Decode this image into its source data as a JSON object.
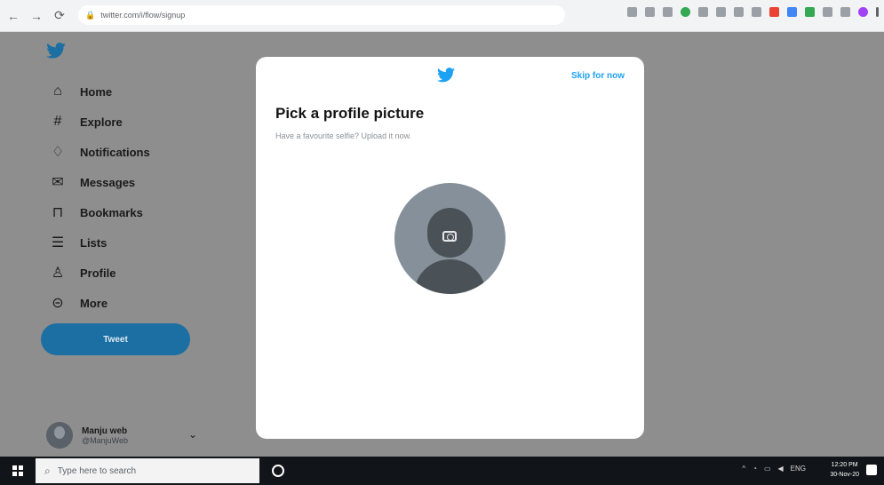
{
  "browser": {
    "url": "twitter.com/i/flow/signup",
    "nav_icons": [
      "back-icon",
      "forward-icon",
      "reload-icon"
    ]
  },
  "sidebar": {
    "items": [
      {
        "label": "Home",
        "icon": "home-icon",
        "glyph": "⌂"
      },
      {
        "label": "Explore",
        "icon": "hashtag-icon",
        "glyph": "#"
      },
      {
        "label": "Notifications",
        "icon": "bell-icon",
        "glyph": "🔔"
      },
      {
        "label": "Messages",
        "icon": "envelope-icon",
        "glyph": "✉"
      },
      {
        "label": "Bookmarks",
        "icon": "bookmark-icon",
        "glyph": "🔖"
      },
      {
        "label": "Lists",
        "icon": "list-icon",
        "glyph": "☰"
      },
      {
        "label": "Profile",
        "icon": "person-icon",
        "glyph": "👤"
      },
      {
        "label": "More",
        "icon": "more-icon",
        "glyph": "⋯"
      }
    ],
    "tweet_label": "Tweet",
    "account": {
      "name": "Manju web",
      "handle": "@ManjuWeb"
    }
  },
  "modal": {
    "skip_label": "Skip for now",
    "title": "Pick a profile picture",
    "subtitle": "Have a favourite selfie? Upload it now."
  },
  "taskbar": {
    "search_placeholder": "Type here to search",
    "lang": "ENG",
    "time": "12:20 PM",
    "date": "30-Nov-20"
  },
  "colors": {
    "twitter_blue": "#1da1f2",
    "tweet_button": "#1b6fa3",
    "overlay": "#8e8e8e"
  }
}
